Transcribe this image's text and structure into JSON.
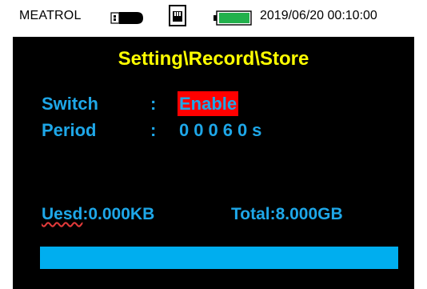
{
  "status_bar": {
    "brand": "MEATROL",
    "datetime": "2019/06/20 00:10:00",
    "usb_icon": "usb-drive-icon",
    "sd_icon": "sd-card-icon",
    "battery_icon": "battery-icon",
    "battery_color": "#22b14c"
  },
  "title": "Setting\\Record\\Store",
  "settings": {
    "switch": {
      "label": "Switch",
      "separator": ":",
      "value": "Enable",
      "highlight_color": "#ff0000"
    },
    "period": {
      "label": "Period",
      "separator": ":",
      "value": "00060s"
    }
  },
  "storage": {
    "used_key": "Uesd",
    "used_value": ":0.000KB",
    "total": "Total:8.000GB",
    "bar_fill_fraction": 1.0
  },
  "colors": {
    "accent": "#1ea7e8",
    "title": "#ffff00",
    "bar": "#00aeef"
  }
}
